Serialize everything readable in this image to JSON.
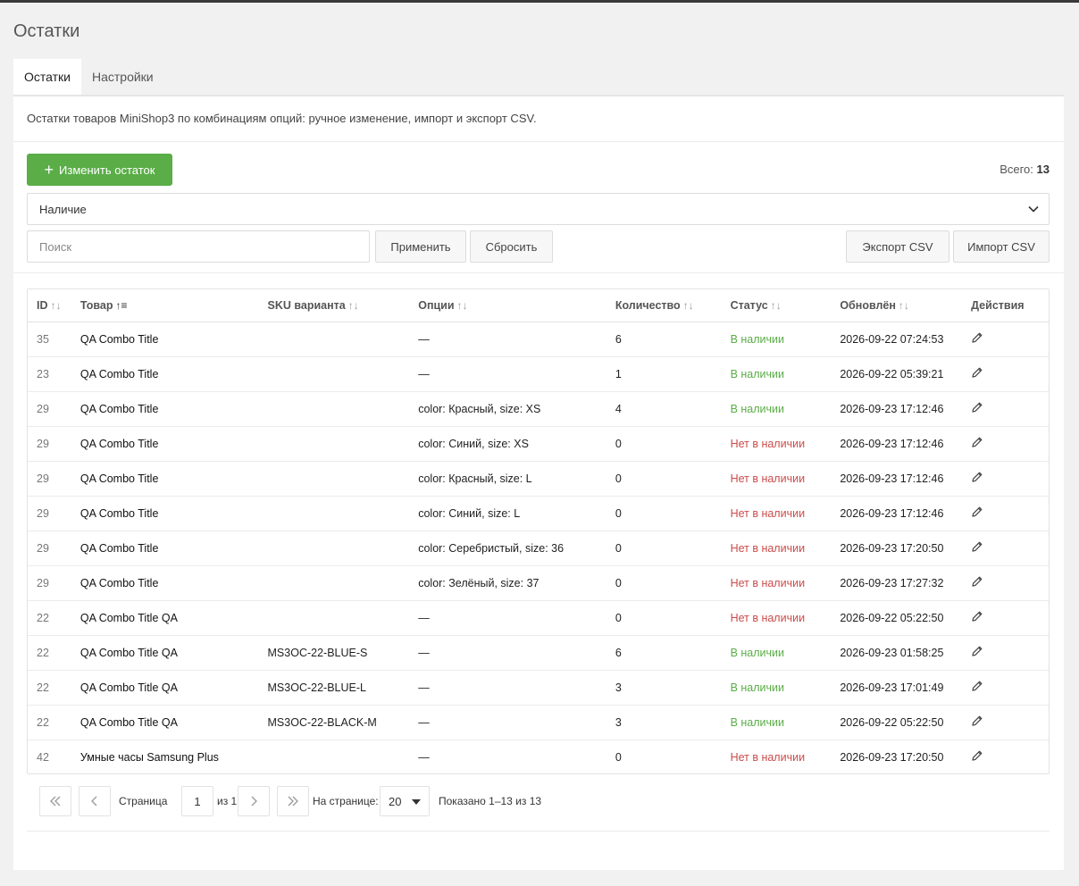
{
  "page_title": "Остатки",
  "tabs": [
    {
      "label": "Остатки",
      "active": true
    },
    {
      "label": "Настройки",
      "active": false
    }
  ],
  "description": "Остатки товаров MiniShop3 по комбинациям опций: ручное изменение, импорт и экспорт CSV.",
  "toolbar": {
    "add_button": "Изменить остаток",
    "total_label": "Всего:",
    "total_value": "13",
    "filter_value": "Наличие",
    "search_placeholder": "Поиск",
    "apply": "Применить",
    "reset": "Сбросить",
    "export": "Экспорт CSV",
    "import": "Импорт CSV"
  },
  "table": {
    "headers": [
      "ID",
      "Товар",
      "SKU варианта",
      "Опции",
      "Количество",
      "Статус",
      "Обновлён",
      "Действия"
    ],
    "rows": [
      {
        "id": "35",
        "product": "QA Combo Title",
        "sku": "",
        "options": "—",
        "qty": "6",
        "status": "В наличии",
        "in_stock": true,
        "updated": "2026-09-22 07:24:53"
      },
      {
        "id": "23",
        "product": "QA Combo Title",
        "sku": "",
        "options": "—",
        "qty": "1",
        "status": "В наличии",
        "in_stock": true,
        "updated": "2026-09-22 05:39:21"
      },
      {
        "id": "29",
        "product": "QA Combo Title",
        "sku": "",
        "options": "color: Красный, size: XS",
        "qty": "4",
        "status": "В наличии",
        "in_stock": true,
        "updated": "2026-09-23 17:12:46"
      },
      {
        "id": "29",
        "product": "QA Combo Title",
        "sku": "",
        "options": "color: Синий, size: XS",
        "qty": "0",
        "status": "Нет в наличии",
        "in_stock": false,
        "updated": "2026-09-23 17:12:46"
      },
      {
        "id": "29",
        "product": "QA Combo Title",
        "sku": "",
        "options": "color: Красный, size: L",
        "qty": "0",
        "status": "Нет в наличии",
        "in_stock": false,
        "updated": "2026-09-23 17:12:46"
      },
      {
        "id": "29",
        "product": "QA Combo Title",
        "sku": "",
        "options": "color: Синий, size: L",
        "qty": "0",
        "status": "Нет в наличии",
        "in_stock": false,
        "updated": "2026-09-23 17:12:46"
      },
      {
        "id": "29",
        "product": "QA Combo Title",
        "sku": "",
        "options": "color: Серебристый, size: 36",
        "qty": "0",
        "status": "Нет в наличии",
        "in_stock": false,
        "updated": "2026-09-23 17:20:50"
      },
      {
        "id": "29",
        "product": "QA Combo Title",
        "sku": "",
        "options": "color: Зелёный, size: 37",
        "qty": "0",
        "status": "Нет в наличии",
        "in_stock": false,
        "updated": "2026-09-23 17:27:32"
      },
      {
        "id": "22",
        "product": "QA Combo Title QA",
        "sku": "",
        "options": "—",
        "qty": "0",
        "status": "Нет в наличии",
        "in_stock": false,
        "updated": "2026-09-22 05:22:50"
      },
      {
        "id": "22",
        "product": "QA Combo Title QA",
        "sku": "MS3OC-22-BLUE-S",
        "options": "—",
        "qty": "6",
        "status": "В наличии",
        "in_stock": true,
        "updated": "2026-09-23 01:58:25"
      },
      {
        "id": "22",
        "product": "QA Combo Title QA",
        "sku": "MS3OC-22-BLUE-L",
        "options": "—",
        "qty": "3",
        "status": "В наличии",
        "in_stock": true,
        "updated": "2026-09-23 17:01:49"
      },
      {
        "id": "22",
        "product": "QA Combo Title QA",
        "sku": "MS3OC-22-BLACK-M",
        "options": "—",
        "qty": "3",
        "status": "В наличии",
        "in_stock": true,
        "updated": "2026-09-22 05:22:50"
      },
      {
        "id": "42",
        "product": "Умные часы Samsung Plus",
        "sku": "",
        "options": "—",
        "qty": "0",
        "status": "Нет в наличии",
        "in_stock": false,
        "updated": "2026-09-23 17:20:50"
      }
    ]
  },
  "pagination": {
    "page_label": "Страница",
    "page_value": "1",
    "of_label": "из 1",
    "per_page_label": "На странице:",
    "per_page_value": "20",
    "shown": "Показано 1–13 из 13"
  },
  "colors": {
    "accent": "#5aad47",
    "in_stock": "#5aad47",
    "out_of_stock": "#cc4b4b"
  },
  "icons": {
    "add": "plus-icon",
    "dropdown": "chevron-down-icon",
    "sort": "sort-icon",
    "edit": "pencil-icon",
    "first": "double-chevron-left-icon",
    "prev": "chevron-left-icon",
    "next": "chevron-right-icon",
    "last": "double-chevron-right-icon"
  }
}
